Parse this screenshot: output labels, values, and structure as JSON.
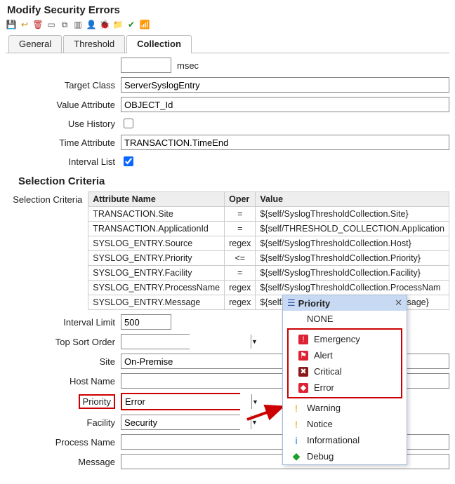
{
  "title": "Modify Security Errors",
  "tabs": [
    "General",
    "Threshold",
    "Collection"
  ],
  "active_tab": 2,
  "rowcut": {
    "label": "…",
    "value": "…",
    "unit": "msec"
  },
  "collection": {
    "target_class_label": "Target Class",
    "target_class": "ServerSyslogEntry",
    "value_attr_label": "Value Attribute",
    "value_attr": "OBJECT_Id",
    "use_history_label": "Use History",
    "use_history": false,
    "time_attr_label": "Time Attribute",
    "time_attr": "TRANSACTION.TimeEnd",
    "interval_list_label": "Interval List",
    "interval_list": true
  },
  "criteria_section": "Selection Criteria",
  "criteria_label": "Selection Criteria",
  "criteria_headers": [
    "Attribute Name",
    "Oper",
    "Value"
  ],
  "criteria": [
    {
      "attr": "TRANSACTION.Site",
      "oper": "=",
      "value": "${self/SyslogThresholdCollection.Site}"
    },
    {
      "attr": "TRANSACTION.ApplicationId",
      "oper": "=",
      "value": "${self/THRESHOLD_COLLECTION.Application"
    },
    {
      "attr": "SYSLOG_ENTRY.Source",
      "oper": "regex",
      "value": "${self/SyslogThresholdCollection.Host}"
    },
    {
      "attr": "SYSLOG_ENTRY.Priority",
      "oper": "<=",
      "value": "${self/SyslogThresholdCollection.Priority}"
    },
    {
      "attr": "SYSLOG_ENTRY.Facility",
      "oper": "=",
      "value": "${self/SyslogThresholdCollection.Facility}"
    },
    {
      "attr": "SYSLOG_ENTRY.ProcessName",
      "oper": "regex",
      "value": "${self/SyslogThresholdCollection.ProcessNam"
    },
    {
      "attr": "SYSLOG_ENTRY.Message",
      "oper": "regex",
      "value": "${self/SyslogThresholdCollection.Message}"
    }
  ],
  "fields": {
    "interval_limit_label": "Interval Limit",
    "interval_limit": "500",
    "top_sort_label": "Top Sort Order",
    "top_sort": "",
    "site_label": "Site",
    "site": "On-Premise",
    "host_label": "Host Name",
    "host": "",
    "priority_label": "Priority",
    "priority": "Error",
    "facility_label": "Facility",
    "facility": "Security",
    "process_label": "Process Name",
    "process": "",
    "message_label": "Message",
    "message": ""
  },
  "popup": {
    "title": "Priority",
    "none": "NONE",
    "items": [
      "Emergency",
      "Alert",
      "Critical",
      "Error",
      "Warning",
      "Notice",
      "Informational",
      "Debug"
    ],
    "colors": [
      "#d23",
      "#d23",
      "#8b1919",
      "#d23",
      "#e79b00",
      "#e79b00",
      "#1f7fd6",
      "#1aa02a"
    ],
    "glyphs": [
      "!",
      "⚑",
      "✖",
      "◆",
      "!",
      "!",
      "i",
      "◆"
    ]
  }
}
